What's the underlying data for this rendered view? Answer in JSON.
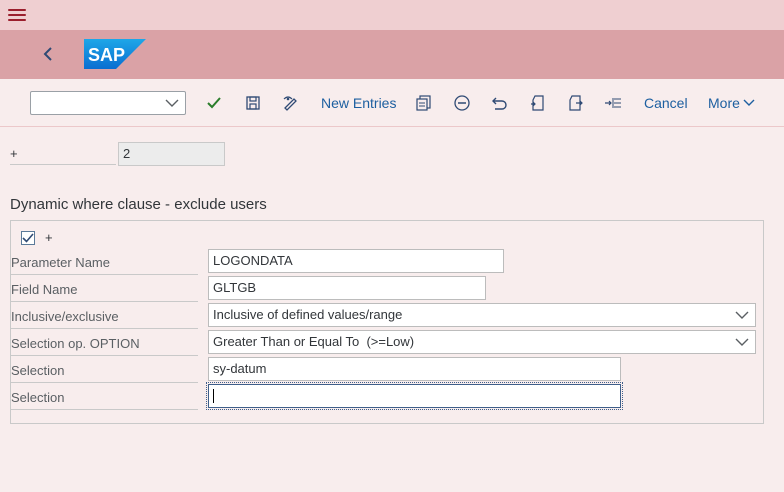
{
  "shell": {
    "logo_text": "SAP"
  },
  "toolbar": {
    "command_value": "",
    "new_entries_label": "New Entries",
    "cancel_label": "Cancel",
    "more_label": "More"
  },
  "header": {
    "label": "+",
    "value": "2"
  },
  "section": {
    "title": "Dynamic where clause - exclude users",
    "checkbox_label": "+",
    "checkbox_checked": true,
    "rows": [
      {
        "label": "Parameter Name",
        "value": "LOGONDATA"
      },
      {
        "label": "Field Name",
        "value": "GLTGB"
      },
      {
        "label": "Inclusive/exclusive",
        "value": "Inclusive of defined values/range"
      },
      {
        "label": "Selection op. OPTION",
        "value": "Greater Than or Equal To  (>=Low)"
      },
      {
        "label": "Selection",
        "value": "sy-datum"
      },
      {
        "label": "Selection",
        "value": ""
      }
    ]
  },
  "colors": {
    "shell_top": "#efcfd1",
    "shell_bar": "#daa2a6",
    "background": "#f8eded",
    "link": "#1d5fa0",
    "accent_red": "#9b1f2d",
    "check_green": "#2b7d2b"
  }
}
